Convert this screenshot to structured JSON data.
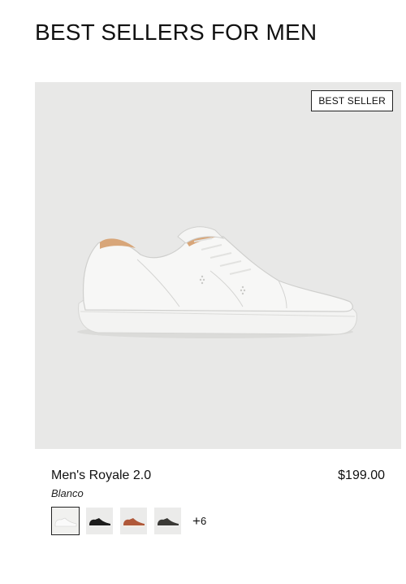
{
  "section": {
    "title": "BEST SELLERS FOR MEN"
  },
  "product": {
    "badge": "BEST SELLER",
    "name": "Men's Royale 2.0",
    "color_name": "Blanco",
    "price": "$199.00",
    "swatches": [
      {
        "name": "white",
        "color": "#f4f4f2",
        "selected": true
      },
      {
        "name": "black",
        "color": "#1c1c1c",
        "selected": false
      },
      {
        "name": "cognac",
        "color": "#b0593a",
        "selected": false
      },
      {
        "name": "dark-grey",
        "color": "#3a3936",
        "selected": false
      }
    ],
    "more_count": "6"
  },
  "colors": {
    "image_bg": "#e8e8e7",
    "text": "#111111"
  }
}
